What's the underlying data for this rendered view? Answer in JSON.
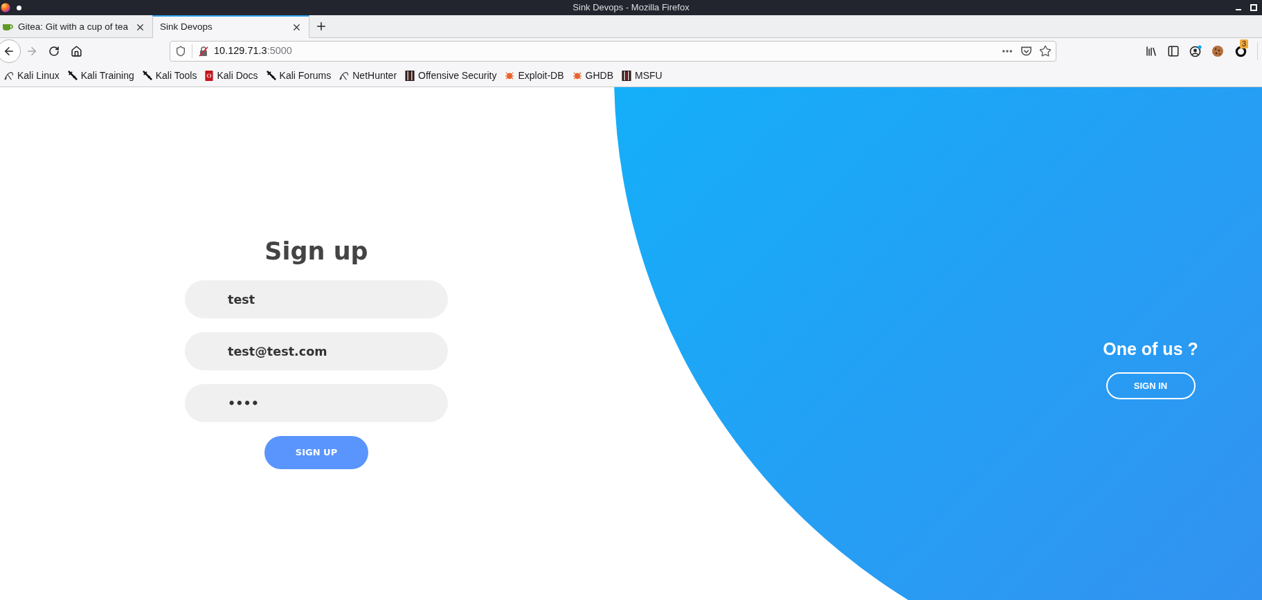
{
  "window": {
    "title": "Sink Devops - Mozilla Firefox"
  },
  "tabs": [
    {
      "title": "Gitea: Git with a cup of tea",
      "kind": "favicon",
      "selected": false
    },
    {
      "title": "Sink Devops",
      "kind": "plain",
      "selected": true
    }
  ],
  "nav_buttons": [
    {
      "kind": "back",
      "disabled": false
    },
    {
      "kind": "forward",
      "disabled": true
    },
    {
      "kind": "reload",
      "disabled": false
    },
    {
      "kind": "home",
      "disabled": false
    }
  ],
  "address_bar": {
    "host": "10.129.71.3",
    "port": ":5000"
  },
  "extensions": {
    "badge": "3"
  },
  "bookmarks": [
    {
      "label": "Kali Linux",
      "kind": "dragon"
    },
    {
      "label": "Kali Training",
      "kind": "dagger"
    },
    {
      "label": "Kali Tools",
      "kind": "dagger"
    },
    {
      "label": "Kali Docs",
      "kind": "book"
    },
    {
      "label": "Kali Forums",
      "kind": "dagger"
    },
    {
      "label": "NetHunter",
      "kind": "dragon"
    },
    {
      "label": "Offensive Security",
      "kind": "tile"
    },
    {
      "label": "Exploit-DB",
      "kind": "bug"
    },
    {
      "label": "GHDB",
      "kind": "bug"
    },
    {
      "label": "MSFU",
      "kind": "tile"
    }
  ],
  "signup": {
    "title": "Sign up",
    "fields": [
      {
        "value": "test"
      },
      {
        "value": "test@test.com"
      },
      {
        "value": "••••"
      }
    ],
    "button": "SIGN UP"
  },
  "signin_panel": {
    "title": "One of us ?",
    "button": "SIGN IN"
  }
}
